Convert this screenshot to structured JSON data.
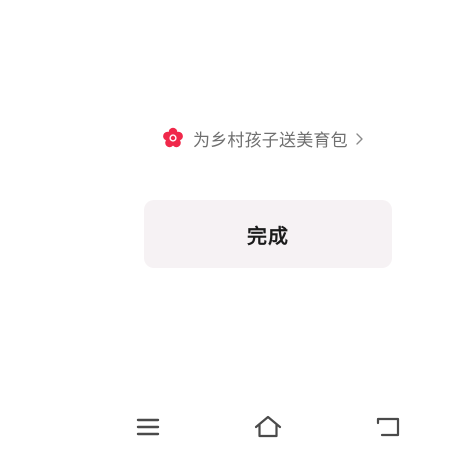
{
  "promo": {
    "icon": "red-flower-icon",
    "text": "为乡村孩子送美育包",
    "chevron": "chevron-right-icon"
  },
  "done_button": {
    "label": "完成"
  },
  "nav_bar": {
    "menu_icon": "menu-icon",
    "home_icon": "home-icon",
    "back_icon": "back-icon"
  },
  "colors": {
    "flower": "#f0284a",
    "promo_text": "#6f6f6f",
    "button_bg": "#f6f2f4",
    "button_text": "#1b1b1b",
    "nav_icons": "#4a4a4a"
  }
}
